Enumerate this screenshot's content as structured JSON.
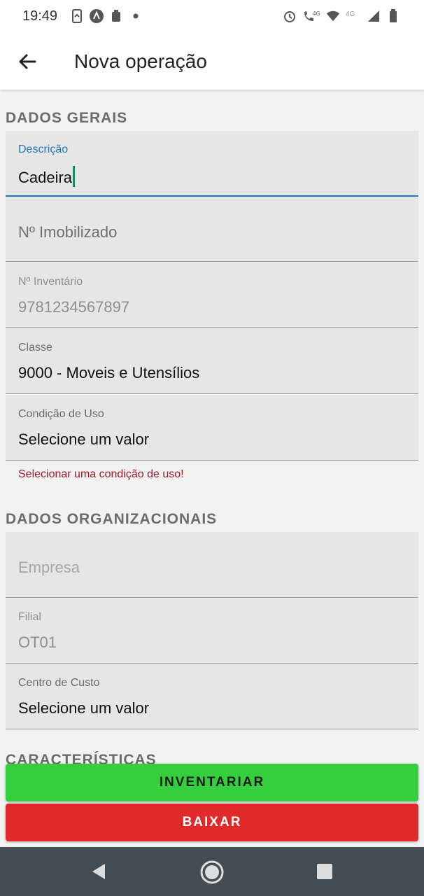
{
  "status_bar": {
    "time": "19:49",
    "left_icons": [
      "screen-share-icon",
      "app-a-icon",
      "app-icon",
      "dot-icon"
    ],
    "right_icons": [
      "alarm-icon",
      "call-4g-icon",
      "wifi-icon",
      "signal-4g-icon",
      "signal-icon",
      "battery-icon"
    ],
    "network_labels": [
      "4G",
      "4G"
    ]
  },
  "app_bar": {
    "title": "Nova operação"
  },
  "sections": {
    "general": "DADOS GERAIS",
    "organizational": "DADOS ORGANIZACIONAIS",
    "characteristics": "CARACTERÍSTICAS"
  },
  "fields": {
    "descricao": {
      "label": "Descrição",
      "value": "Cadeira"
    },
    "imobilizado": {
      "placeholder": "Nº Imobilizado"
    },
    "inventario": {
      "label": "Nº Inventário",
      "value": "9781234567897"
    },
    "classe": {
      "label": "Classe",
      "value": "9000 - Moveis e Utensílios"
    },
    "condicao": {
      "label": "Condição de Uso",
      "value": "Selecione um valor",
      "error": "Selecionar uma condição de uso!"
    },
    "empresa": {
      "placeholder": "Empresa"
    },
    "filial": {
      "label": "Filial",
      "value": "OT01"
    },
    "centro_custo": {
      "label": "Centro de Custo",
      "value": "Selecione um valor"
    }
  },
  "buttons": {
    "inventariar": "INVENTARIAR",
    "baixar": "BAIXAR"
  },
  "colors": {
    "accent": "#1e78c8",
    "error": "#a0182a",
    "inventariar_bg": "#35cf3d",
    "baixar_bg": "#e02a2a",
    "nav_bar_bg": "#444c53"
  }
}
